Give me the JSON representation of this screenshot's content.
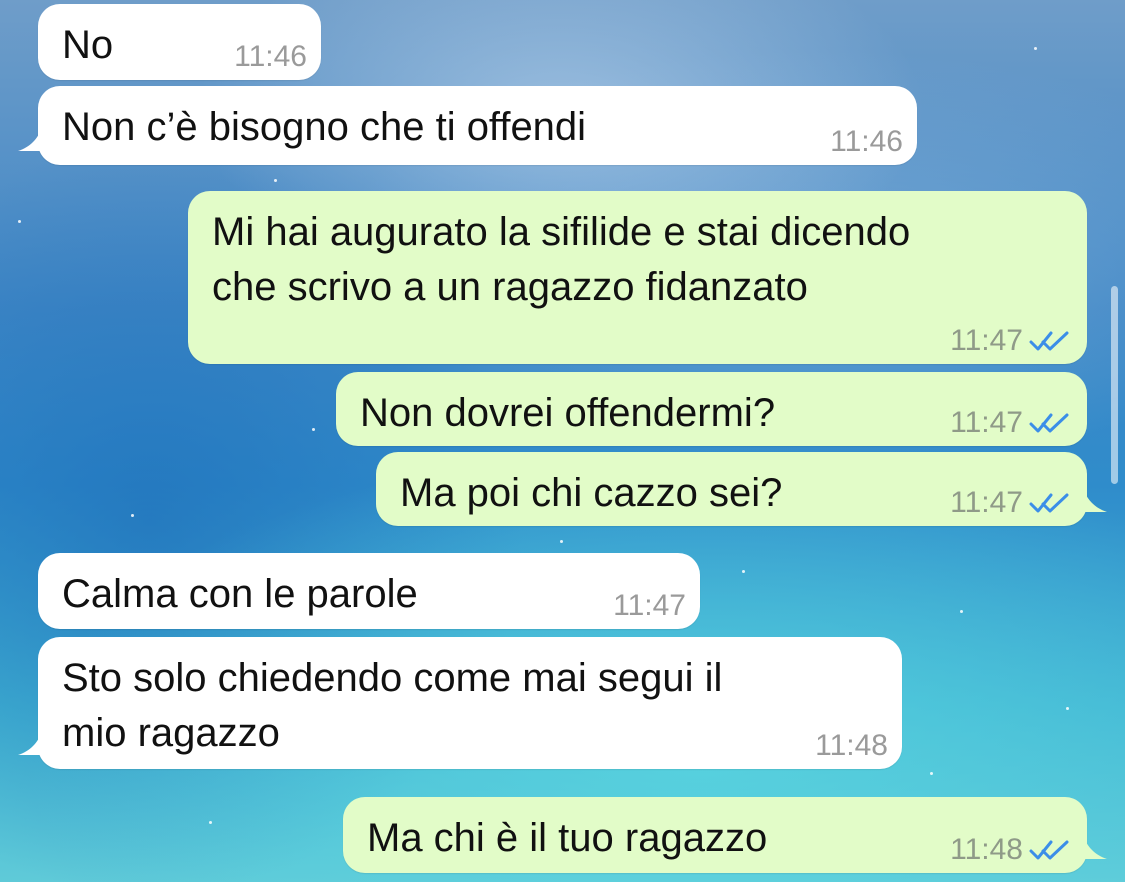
{
  "messages": [
    {
      "id": "m1",
      "direction": "incoming",
      "text": "No",
      "time": "11:46"
    },
    {
      "id": "m2",
      "direction": "incoming",
      "text": "Non c’è bisogno che ti offendi",
      "time": "11:46"
    },
    {
      "id": "m3",
      "direction": "outgoing",
      "text": "Mi hai augurato la sifilide e stai dicendo\nche scrivo a un ragazzo fidanzato",
      "time": "11:47",
      "status": "read"
    },
    {
      "id": "m4",
      "direction": "outgoing",
      "text": "Non dovrei offendermi?",
      "time": "11:47",
      "status": "read"
    },
    {
      "id": "m5",
      "direction": "outgoing",
      "text": "Ma poi chi cazzo sei?",
      "time": "11:47",
      "status": "read"
    },
    {
      "id": "m6",
      "direction": "incoming",
      "text": "Calma con le parole",
      "time": "11:47"
    },
    {
      "id": "m7",
      "direction": "incoming",
      "text": "Sto solo chiedendo come mai segui il\nmio ragazzo",
      "time": "11:48"
    },
    {
      "id": "m8",
      "direction": "outgoing",
      "text": "Ma chi è il tuo ragazzo",
      "time": "11:48",
      "status": "read"
    }
  ],
  "colors": {
    "incoming_bubble": "#ffffff",
    "outgoing_bubble": "#e2fcc8",
    "read_ticks": "#3b8ee8",
    "timestamp": "#9a9a9a"
  },
  "icons": {
    "read_status": "double-check-icon",
    "bubble_tail": "bubble-tail-icon"
  }
}
